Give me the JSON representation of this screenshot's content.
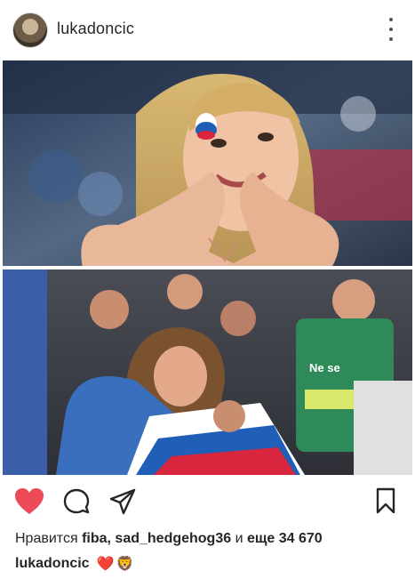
{
  "post": {
    "username": "lukadoncic"
  },
  "likes": {
    "prefix": "Нравится",
    "user1": "fiba",
    "separator": ",",
    "user2": "sad_hedgehog36",
    "conjunction": "и",
    "more": "еще 34 670"
  },
  "caption": {
    "username": "lukadoncic",
    "emoji1": "❤️",
    "emoji2": "🦁"
  },
  "icons": {
    "like": "heart-icon",
    "comment": "comment-icon",
    "share": "share-icon",
    "save": "bookmark-icon",
    "more": "more-options-icon"
  },
  "colors": {
    "like_active": "#ed4956",
    "text": "#262626"
  }
}
